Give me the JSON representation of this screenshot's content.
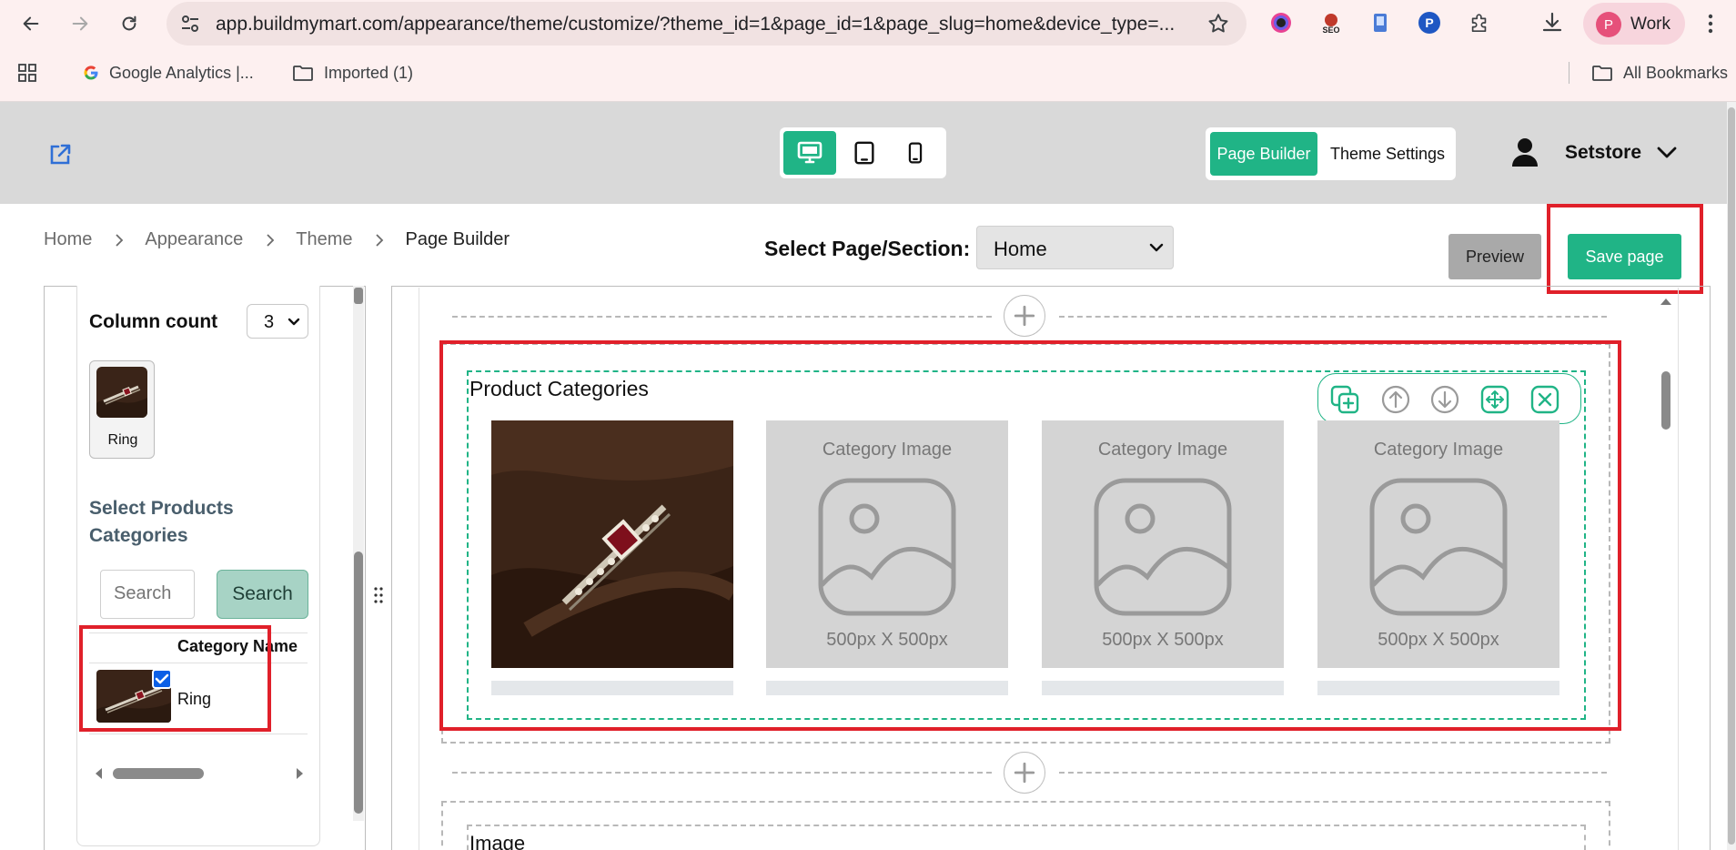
{
  "browser": {
    "url": "app.buildmymart.com/appearance/theme/customize/?theme_id=1&page_id=1&page_slug=home&device_type=...",
    "profile_initial": "P",
    "profile_name": "Work",
    "bookmarks": [
      {
        "label": "Google Analytics  |..."
      },
      {
        "label": "Imported (1)"
      }
    ],
    "all_bookmarks": "All Bookmarks"
  },
  "header": {
    "page_builder_label": "Page Builder",
    "theme_settings_label": "Theme Settings",
    "store_name": "Setstore",
    "accent_color": "#20b486"
  },
  "breadcrumb": {
    "items": [
      "Home",
      "Appearance",
      "Theme"
    ],
    "current": "Page Builder"
  },
  "page_select": {
    "label": "Select Page/Section:",
    "value": "Home"
  },
  "actions": {
    "preview": "Preview",
    "save": "Save page"
  },
  "settings_panel": {
    "column_count_label": "Column count",
    "column_count_value": "3",
    "selected_category": "Ring",
    "select_categories_title": "Select Products Categories",
    "search_placeholder": "Search",
    "search_button": "Search",
    "table_header": "Category Name",
    "rows": [
      {
        "name": "Ring",
        "checked": true
      }
    ]
  },
  "canvas": {
    "section_title": "Product Categories",
    "placeholder_title": "Category Image",
    "placeholder_size": "500px X 500px",
    "next_section_title": "Image"
  }
}
